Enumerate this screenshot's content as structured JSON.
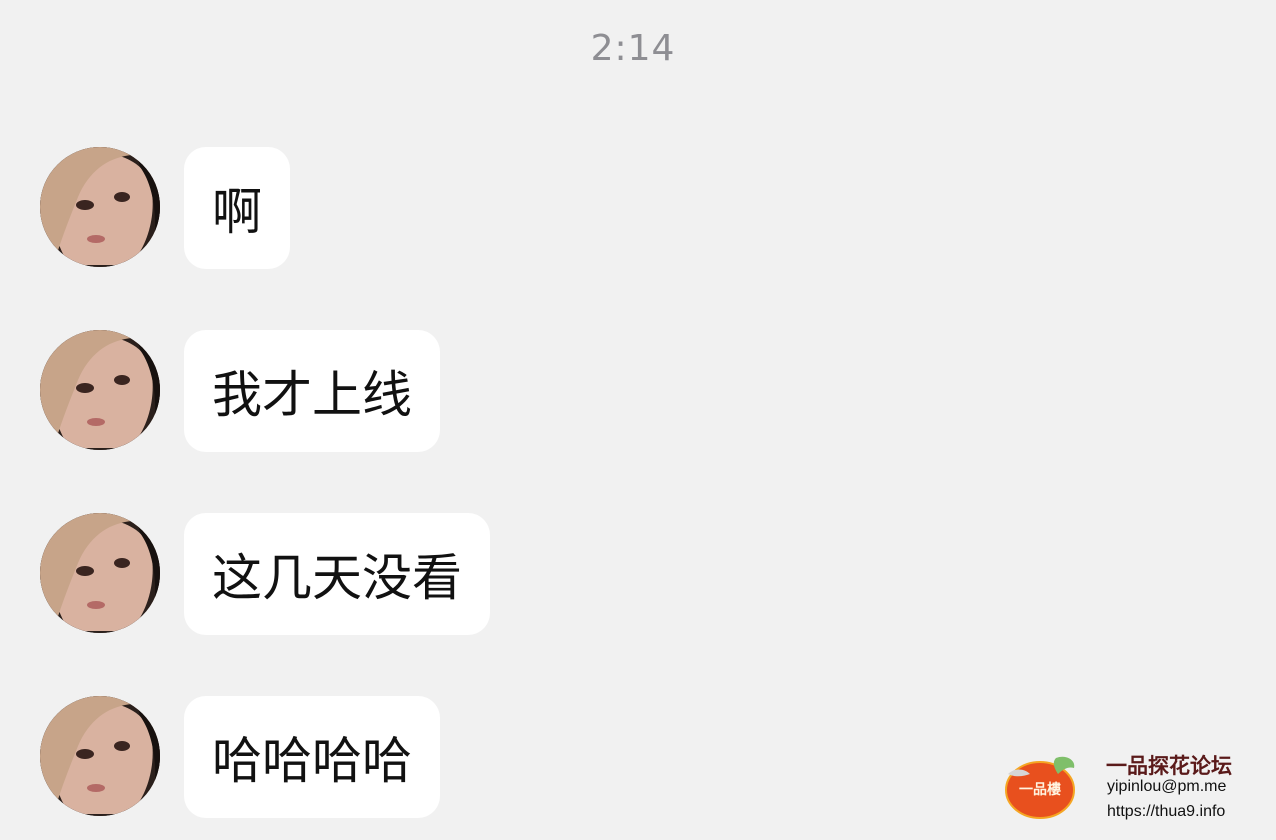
{
  "chat": {
    "timestamp": "2:14",
    "messages": [
      {
        "sender": "contact",
        "avatar": "contact-avatar",
        "text": "啊"
      },
      {
        "sender": "contact",
        "avatar": "contact-avatar",
        "text": "我才上线"
      },
      {
        "sender": "contact",
        "avatar": "contact-avatar",
        "text": "这几天没看"
      },
      {
        "sender": "contact",
        "avatar": "contact-avatar",
        "text": "哈哈哈哈"
      }
    ]
  },
  "watermark": {
    "logo_text": "一品樓",
    "title": "一品探花论坛",
    "email": "yipinlou@pm.me",
    "url": "https://thua9.info"
  },
  "colors": {
    "background": "#f1f1f1",
    "bubble": "#ffffff",
    "timestamp": "#8e8e93",
    "watermark_title": "#5a1a1a"
  }
}
